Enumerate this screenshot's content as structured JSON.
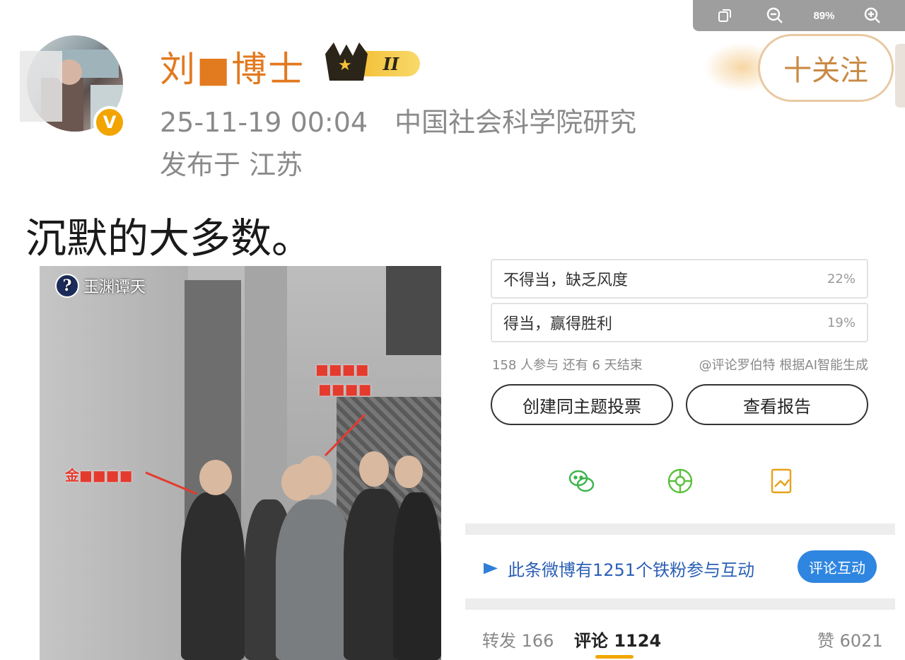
{
  "viewer": {
    "zoom": "89%"
  },
  "post": {
    "author": "刘■博士",
    "vip_level": "II",
    "follow_label": "十关注",
    "time": "25-11-19 00:04",
    "source": "中国社会科学院研究",
    "location": "发布于 江苏",
    "text": "沉默的大多数。"
  },
  "photo": {
    "watermark": "玉渊谭天",
    "annotations": [
      "金■■■■",
      "■■■■",
      "■■■■"
    ]
  },
  "embedded": {
    "poll_options": [
      {
        "label": "不得当，缺乏风度",
        "pct": "22%"
      },
      {
        "label": "得当，赢得胜利",
        "pct": "19%"
      }
    ],
    "participants": "158 人参与 还有 6 天结束",
    "ai_note": "@评论罗伯特 根据AI智能生成",
    "create_poll": "创建同主题投票",
    "view_report": "查看报告",
    "share_icons": [
      "wechat-icon",
      "moments-icon",
      "poster-icon"
    ],
    "fans_text": "此条微博有1251个铁粉参与互动",
    "comment_interact": "评论互动",
    "stats": {
      "repost": "转发 166",
      "comment": "评论 1124",
      "like": "赞 6021"
    }
  },
  "colors": {
    "author": "#e27a1f",
    "accent": "#f2a500",
    "link": "#2b5fb5",
    "button_blue": "#2f86e0"
  }
}
